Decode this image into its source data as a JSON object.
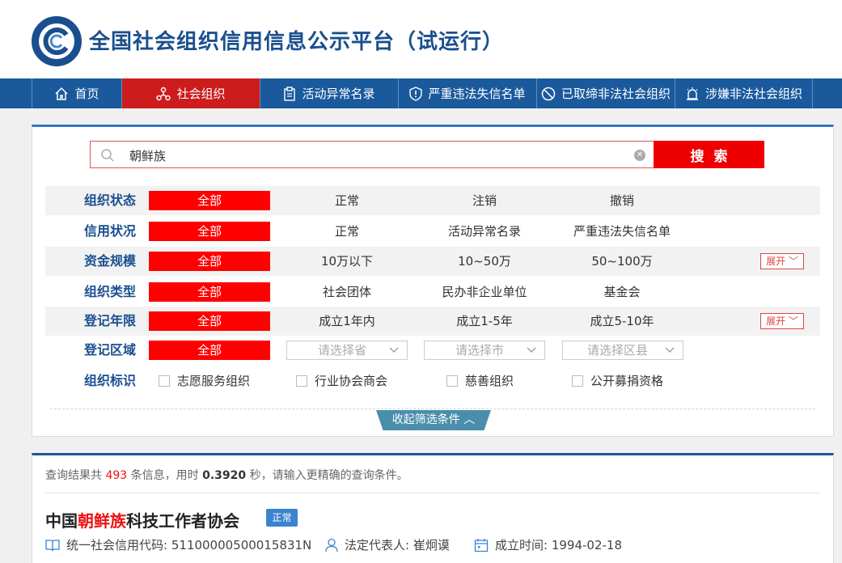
{
  "site": {
    "title": "全国社会组织信用信息公示平台（试运行）"
  },
  "nav": [
    {
      "label": "首页",
      "icon": "home-icon"
    },
    {
      "label": "社会组织",
      "icon": "org-network-icon"
    },
    {
      "label": "活动异常名录",
      "icon": "clipboard-icon"
    },
    {
      "label": "严重违法失信名单",
      "icon": "shield-alert-icon"
    },
    {
      "label": "已取缔非法社会组织",
      "icon": "ban-icon"
    },
    {
      "label": "涉嫌非法社会组织",
      "icon": "alarm-bell-icon"
    }
  ],
  "search": {
    "value": "朝鲜族",
    "button": "搜索"
  },
  "filters": {
    "status": {
      "label": "组织状态",
      "all": "全部",
      "options": [
        "正常",
        "注销",
        "撤销"
      ]
    },
    "credit": {
      "label": "信用状况",
      "all": "全部",
      "options": [
        "正常",
        "活动异常名录",
        "严重违法失信名单"
      ]
    },
    "capital": {
      "label": "资金规模",
      "all": "全部",
      "options": [
        "10万以下",
        "10~50万",
        "50~100万"
      ],
      "expand": "展开"
    },
    "type": {
      "label": "组织类型",
      "all": "全部",
      "options": [
        "社会团体",
        "民办非企业单位",
        "基金会"
      ]
    },
    "years": {
      "label": "登记年限",
      "all": "全部",
      "options": [
        "成立1年内",
        "成立1-5年",
        "成立5-10年"
      ],
      "expand": "展开"
    },
    "region": {
      "label": "登记区域",
      "all": "全部",
      "province": "请选择省",
      "city": "请选择市",
      "county": "请选择区县"
    },
    "tags": {
      "label": "组织标识",
      "options": [
        "志愿服务组织",
        "行业协会商会",
        "慈善组织",
        "公开募捐资格"
      ]
    },
    "collapse": "收起筛选条件"
  },
  "results": {
    "stats": {
      "prefix": "查询结果共",
      "count": "493",
      "mid": "条信息，用时",
      "time": "0.3920",
      "suffix": "秒，请输入更精确的查询条件。"
    },
    "first": {
      "name_prefix": "中国",
      "name_highlight": "朝鲜族",
      "name_suffix": "科技工作者协会",
      "status": "正常",
      "credit_code": "统一社会信用代码: 51100000500015831N",
      "legal_rep": "法定代表人: 崔炯谟",
      "founded": "成立时间: 1994-02-18"
    }
  },
  "colors": {
    "brand_blue": "#1a5a9c",
    "active_red": "#cc1c1c",
    "filter_red": "#ff0000"
  }
}
